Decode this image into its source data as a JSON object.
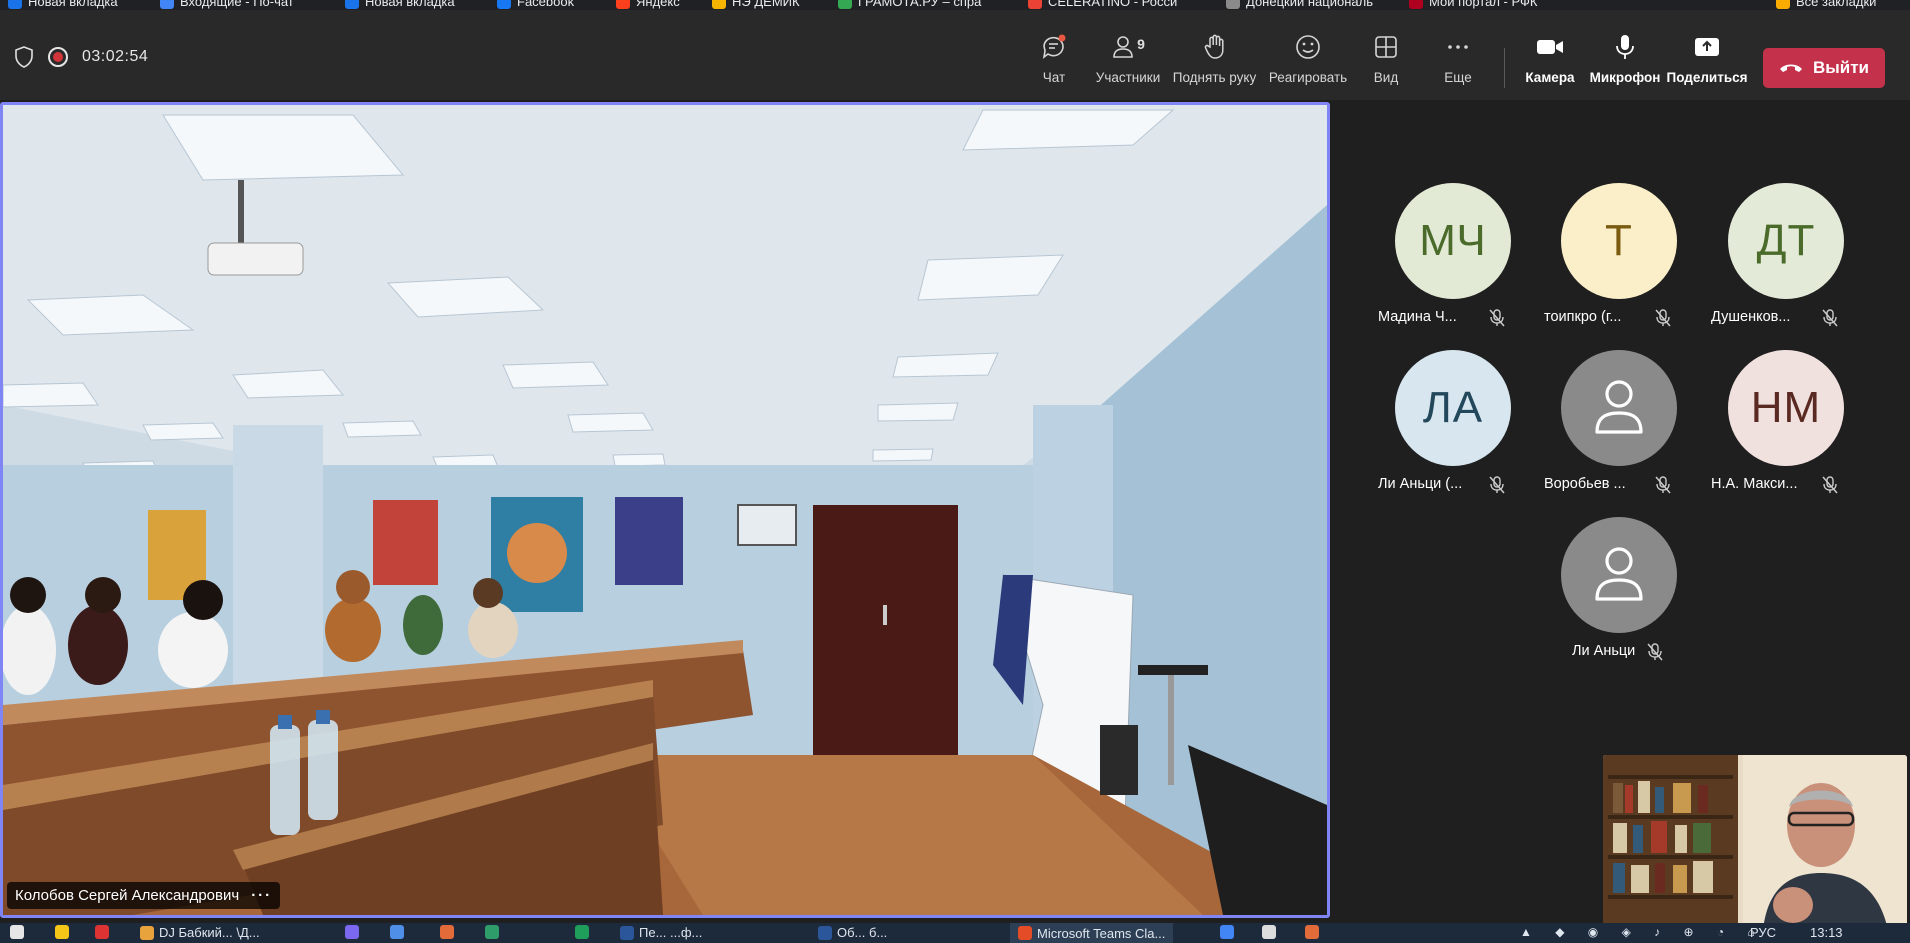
{
  "bookmarks": [
    {
      "label": "Новая вкладка",
      "color": "#1a73e8"
    },
    {
      "label": "Входящие - По-чат",
      "color": "#4285f4"
    },
    {
      "label": "Новая вкладка",
      "color": "#1a73e8"
    },
    {
      "label": "Facebook",
      "color": "#1877f2"
    },
    {
      "label": "Яндекс",
      "color": "#fc3f1d"
    },
    {
      "label": "НЭ ДЕМИК",
      "color": "#f4b400"
    },
    {
      "label": "ГРАМОТА.РУ – спра",
      "color": "#34a853"
    },
    {
      "label": "CELERATINO - Росси",
      "color": "#ea4335"
    },
    {
      "label": "Донецкий националь",
      "color": "#8a8a8a"
    },
    {
      "label": "Мой портал - РФК",
      "color": "#b00020"
    },
    {
      "label": "Все закладки",
      "color": "#f9ab00"
    }
  ],
  "toolbar": {
    "timer": "03:02:54",
    "buttons": [
      {
        "id": "chat",
        "label": "Чат",
        "icon": "chat-icon"
      },
      {
        "id": "participants",
        "label": "Участники",
        "icon": "people-icon",
        "count": "9"
      },
      {
        "id": "raise-hand",
        "label": "Поднять руку",
        "icon": "hand-icon"
      },
      {
        "id": "react",
        "label": "Реагировать",
        "icon": "smiley-icon"
      },
      {
        "id": "view",
        "label": "Вид",
        "icon": "layout-icon"
      },
      {
        "id": "more",
        "label": "Еще",
        "icon": "ellipsis-icon"
      },
      {
        "id": "camera",
        "label": "Камера",
        "icon": "camera-icon"
      },
      {
        "id": "mic",
        "label": "Микрофон",
        "icon": "mic-icon"
      },
      {
        "id": "share",
        "label": "Поделиться",
        "icon": "share-icon"
      }
    ],
    "leave_label": "Выйти",
    "leave_color": "#c4314b"
  },
  "main_video": {
    "speaker_name": "Колобов Сергей Александрович",
    "more": "···"
  },
  "participants": [
    {
      "initials": "МЧ",
      "name": "Мадина Ч...",
      "bg": "#e2ead6",
      "fg": "#4b6b2a"
    },
    {
      "initials": "Т",
      "name": "тоипкро (г...",
      "bg": "#fbefc9",
      "fg": "#7a5b10"
    },
    {
      "initials": "ДТ",
      "name": "Душенков...",
      "bg": "#e3ead8",
      "fg": "#4b6b2a"
    },
    {
      "initials": "ЛА",
      "name": "Ли Аньци (...",
      "bg": "#d8e6ef",
      "fg": "#23485c"
    },
    {
      "initials": "",
      "name": "Воробьев ...",
      "bg": "#8a8a8a",
      "fg": "#ffffff"
    },
    {
      "initials": "НМ",
      "name": "Н.А. Макси...",
      "bg": "#f0e0de",
      "fg": "#5a2a22"
    },
    {
      "initials": "",
      "name": "Ли Аньци",
      "bg": "#8a8a8a",
      "fg": "#ffffff"
    }
  ],
  "taskbar": [
    {
      "label": "Яндекс",
      "color": "#f5c518"
    },
    {
      "label": "DJ Бабкий...  \\Д...",
      "color": "#e8a33c"
    },
    {
      "label": "",
      "color": "#7b68ee"
    },
    {
      "label": "",
      "color": "#4f8fe8"
    },
    {
      "label": "",
      "color": "#e36b3a"
    },
    {
      "label": "",
      "color": "#2e9d6a"
    },
    {
      "label": "",
      "color": "#1e9e5a"
    },
    {
      "label": "Пе...    ...ф...",
      "color": "#2b579a"
    },
    {
      "label": "Об...  б...",
      "color": "#2b579a"
    },
    {
      "label": "Microsoft Teams Cla...",
      "color": "#e34c26"
    },
    {
      "label": "",
      "color": "#4285f4"
    },
    {
      "label": "РУС",
      "color": "#1c2a3c"
    },
    {
      "label": "13:13",
      "color": "#1c2a3c"
    }
  ]
}
